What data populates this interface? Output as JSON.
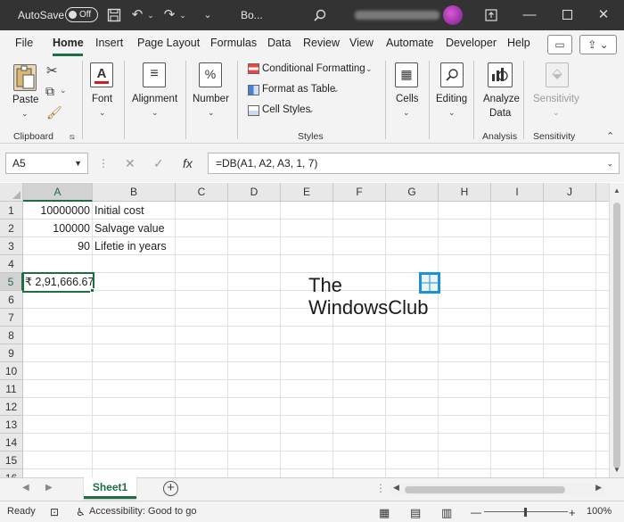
{
  "titlebar": {
    "autosave_label": "AutoSave",
    "autosave_state": "Off",
    "doc_title": "Bo...",
    "icons": [
      "save-icon",
      "undo-icon",
      "redo-icon",
      "customize-qat-icon",
      "search-icon",
      "ribbon-display-icon",
      "minimize-icon",
      "maximize-icon",
      "close-icon"
    ]
  },
  "menu": {
    "tabs": [
      "File",
      "Home",
      "Insert",
      "Page Layout",
      "Formulas",
      "Data",
      "Review",
      "View",
      "Automate",
      "Developer",
      "Help"
    ],
    "active": "Home"
  },
  "ribbon": {
    "paste": "Paste",
    "clipboard_group": "Clipboard",
    "font": "Font",
    "alignment": "Alignment",
    "number": "Number",
    "conditional_formatting": "Conditional Formatting",
    "format_as_table": "Format as Table",
    "cell_styles": "Cell Styles",
    "styles_group": "Styles",
    "cells": "Cells",
    "editing": "Editing",
    "analyze_data_1": "Analyze",
    "analyze_data_2": "Data",
    "analysis_group": "Analysis",
    "sensitivity": "Sensitivity",
    "sensitivity_group": "Sensitivity"
  },
  "formula_bar": {
    "name_box": "A5",
    "formula": "=DB(A1, A2, A3, 1, 7)"
  },
  "sheet": {
    "columns": [
      "A",
      "B",
      "C",
      "D",
      "E",
      "F",
      "G",
      "H",
      "I",
      "J"
    ],
    "rows": [
      "1",
      "2",
      "3",
      "4",
      "5",
      "6",
      "7",
      "8",
      "9",
      "10",
      "11",
      "12",
      "13",
      "14",
      "15",
      "16"
    ],
    "cells": {
      "A1": "10000000",
      "B1": "Initial cost",
      "A2": "100000",
      "B2": "Salvage value",
      "A3": "90",
      "B3": "Lifetie in years",
      "A5": "₹ 2,91,666.67"
    },
    "active_cell": "A5"
  },
  "watermark": {
    "line1": "The",
    "line2": "WindowsClub"
  },
  "sheet_tabs": {
    "tabs": [
      "Sheet1"
    ],
    "active": "Sheet1"
  },
  "statusbar": {
    "ready": "Ready",
    "accessibility": "Accessibility: Good to go",
    "zoom": "100%"
  },
  "colors": {
    "accent": "#1e6e42",
    "titlebar": "#333333",
    "ribbon_bg": "#f3f3f3"
  }
}
